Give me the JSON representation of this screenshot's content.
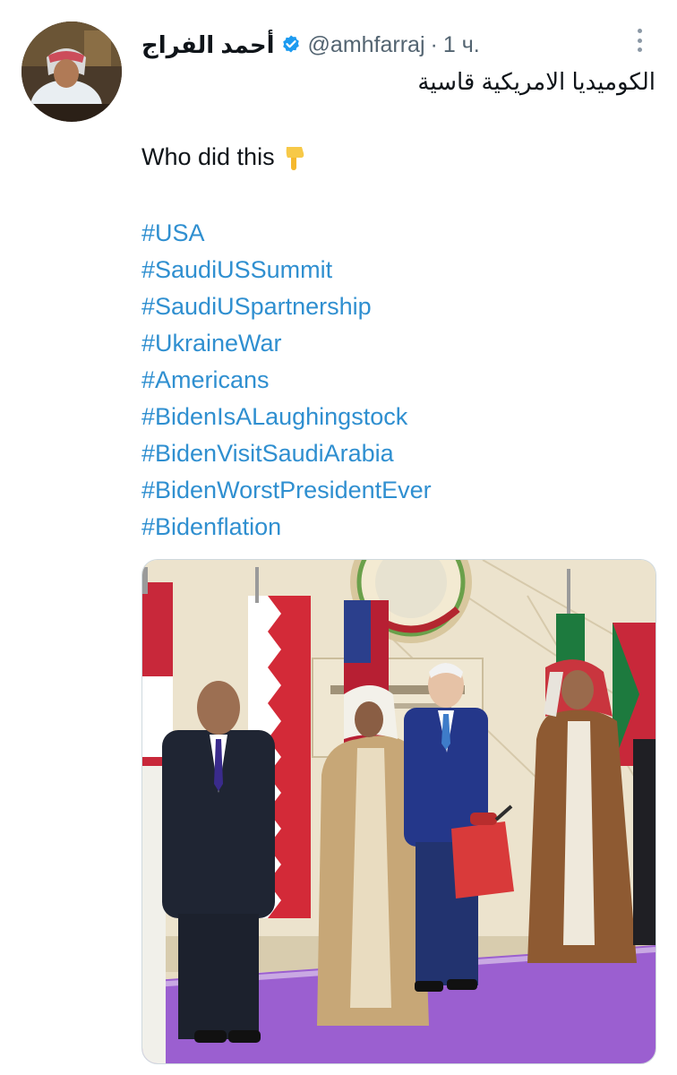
{
  "tweet": {
    "display_name": "أحمد الفراج",
    "handle": "@amhfarraj",
    "separator": "·",
    "time": "1 ч.",
    "arabic_text": "الكوميديا الامريكية قاسية",
    "body_text": "Who did this",
    "hashtags": [
      "#USA",
      "#SaudiUSSummit",
      "#SaudiUSpartnership",
      "#UkraineWar",
      "#Americans",
      "#BidenIsALaughingstock",
      "#BidenVisitSaudiArabia",
      "#BidenWorstPresidentEver",
      "#Bidenflation"
    ]
  },
  "icons": {
    "verified": "verified-badge-icon",
    "more": "more-vertical-icon",
    "emoji": "backhand-index-pointing-down-emoji"
  },
  "colors": {
    "hashtag": "#2f8fd0",
    "verified": "#1d9bf0",
    "text": "#0f1419",
    "secondary": "#536471",
    "carpet": "#9b5fd0"
  }
}
